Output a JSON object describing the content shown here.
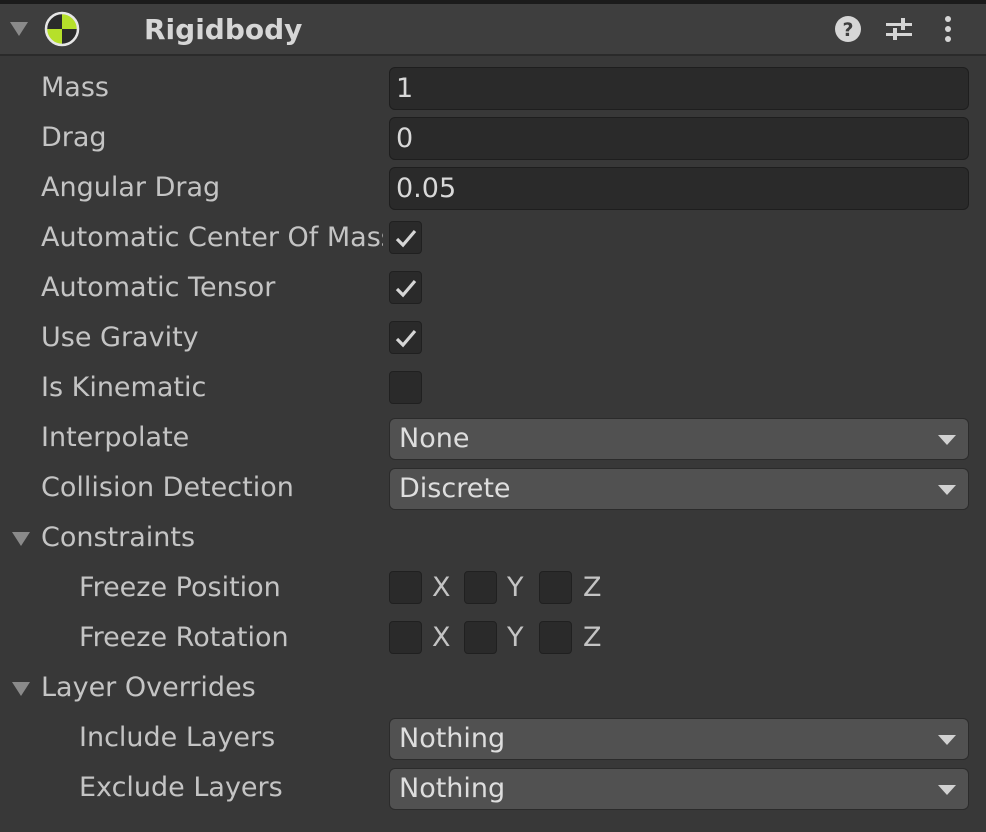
{
  "component": {
    "title": "Rigidbody",
    "icons": [
      "rigidbody-icon",
      "help-icon",
      "presets-icon",
      "more-options-icon"
    ]
  },
  "fields": {
    "mass": {
      "label": "Mass",
      "value": "1"
    },
    "drag": {
      "label": "Drag",
      "value": "0"
    },
    "angular_drag": {
      "label": "Angular Drag",
      "value": "0.05"
    },
    "auto_center": {
      "label": "Automatic Center Of Mass",
      "checked": true
    },
    "auto_tensor": {
      "label": "Automatic Tensor",
      "checked": true
    },
    "use_gravity": {
      "label": "Use Gravity",
      "checked": true
    },
    "is_kinematic": {
      "label": "Is Kinematic",
      "checked": false
    },
    "interpolate": {
      "label": "Interpolate",
      "value": "None"
    },
    "collision_detection": {
      "label": "Collision Detection",
      "value": "Discrete"
    }
  },
  "constraints": {
    "label": "Constraints",
    "freeze_position": {
      "label": "Freeze Position",
      "x": "X",
      "y": "Y",
      "z": "Z"
    },
    "freeze_rotation": {
      "label": "Freeze Rotation",
      "x": "X",
      "y": "Y",
      "z": "Z"
    }
  },
  "layer_overrides": {
    "label": "Layer Overrides",
    "include": {
      "label": "Include Layers",
      "value": "Nothing"
    },
    "exclude": {
      "label": "Exclude Layers",
      "value": "Nothing"
    }
  }
}
